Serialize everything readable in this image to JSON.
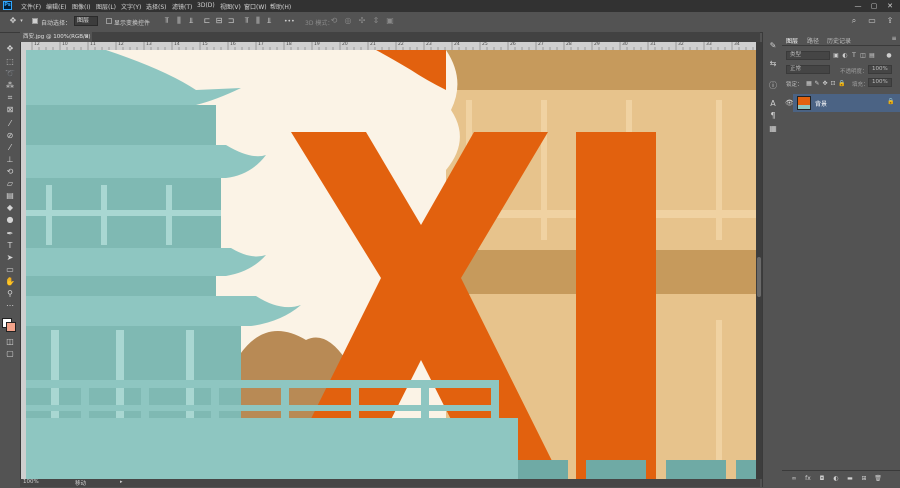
{
  "app": {
    "logo_text": "Ps"
  },
  "menubar": {
    "items": [
      "文件(F)",
      "编辑(E)",
      "图像(I)",
      "图层(L)",
      "文字(Y)",
      "选择(S)",
      "滤镜(T)",
      "3D(D)",
      "视图(V)",
      "窗口(W)",
      "帮助(H)"
    ],
    "window_controls": {
      "minimize": "—",
      "maximize": "▢",
      "close": "✕"
    }
  },
  "options_bar": {
    "auto_select_label": "自动选择：",
    "auto_select_checked": true,
    "target_value": "图层",
    "show_transform_label": "显示变换控件",
    "show_transform_checked": false,
    "more": "•••",
    "mode_label": "3D 模式："
  },
  "document": {
    "tab_title": "西安.jpg @ 100%(RGB/8)",
    "tab_close": "×",
    "ruler_top_ticks": [
      "12",
      "10",
      "11",
      "12",
      "13",
      "14",
      "15",
      "16",
      "17",
      "18",
      "19",
      "20",
      "21",
      "22",
      "23",
      "24",
      "25",
      "26",
      "27",
      "28",
      "29",
      "30",
      "31",
      "32",
      "33",
      "34"
    ],
    "canvas_text": "XI",
    "zoom": "100%",
    "status": "移动"
  },
  "colors": {
    "canvas_cream": "#fbf3e6",
    "teal": "#8ec6c1",
    "teal_dark": "#6faaa5",
    "orange": "#e2610e",
    "sand": "#e7c38c",
    "sand_dark": "#c69a5c",
    "brown": "#b88a55",
    "ps_dark": "#323232",
    "ps_mid": "#535353",
    "layer_selected": "#4b6384"
  },
  "layers_panel": {
    "tabs": [
      "图层",
      "路径",
      "历史记录"
    ],
    "search_placeholder": "类型",
    "blend_mode": "正常",
    "opacity_label": "不透明度：",
    "opacity_value": "100%",
    "lock_label": "锁定：",
    "fill_label": "填充：",
    "fill_value": "100%",
    "layer_name": "背景"
  }
}
